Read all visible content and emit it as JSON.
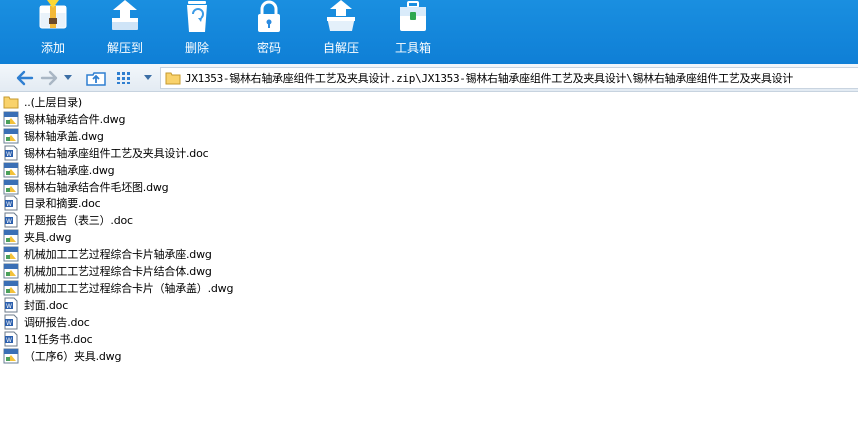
{
  "toolbar": {
    "buttons": [
      {
        "label": "添加",
        "icon": "add-archive-icon"
      },
      {
        "label": "解压到",
        "icon": "extract-to-icon"
      },
      {
        "label": "删除",
        "icon": "recycle-bin-icon"
      },
      {
        "label": "密码",
        "icon": "lock-icon"
      },
      {
        "label": "自解压",
        "icon": "self-extract-icon"
      },
      {
        "label": "工具箱",
        "icon": "toolbox-icon"
      }
    ]
  },
  "navbar": {
    "path": "JX1353-锡林右轴承座组件工艺及夹具设计.zip\\JX1353-锡林右轴承座组件工艺及夹具设计\\锡林右轴承座组件工艺及夹具设计"
  },
  "files": [
    {
      "name": "..(上层目录)",
      "type": "folder"
    },
    {
      "name": "锡林轴承结合件.dwg",
      "type": "dwg"
    },
    {
      "name": "锡林轴承盖.dwg",
      "type": "dwg"
    },
    {
      "name": "锡林右轴承座组件工艺及夹具设计.doc",
      "type": "doc"
    },
    {
      "name": "锡林右轴承座.dwg",
      "type": "dwg"
    },
    {
      "name": "锡林右轴承结合件毛坯图.dwg",
      "type": "dwg"
    },
    {
      "name": "目录和摘要.doc",
      "type": "doc"
    },
    {
      "name": "开题报告（表三）.doc",
      "type": "doc"
    },
    {
      "name": "夹具.dwg",
      "type": "dwg"
    },
    {
      "name": "机械加工工艺过程综合卡片轴承座.dwg",
      "type": "dwg"
    },
    {
      "name": "机械加工工艺过程综合卡片结合体.dwg",
      "type": "dwg"
    },
    {
      "name": "机械加工工艺过程综合卡片（轴承盖）.dwg",
      "type": "dwg"
    },
    {
      "name": "封面.doc",
      "type": "doc"
    },
    {
      "name": "调研报告.doc",
      "type": "doc"
    },
    {
      "name": "11任务书.doc",
      "type": "doc"
    },
    {
      "name": "（工序6）夹具.dwg",
      "type": "dwg"
    }
  ],
  "colors": {
    "toolbar_bg": "#1285db",
    "nav_arrow": "#2f7fd1"
  }
}
